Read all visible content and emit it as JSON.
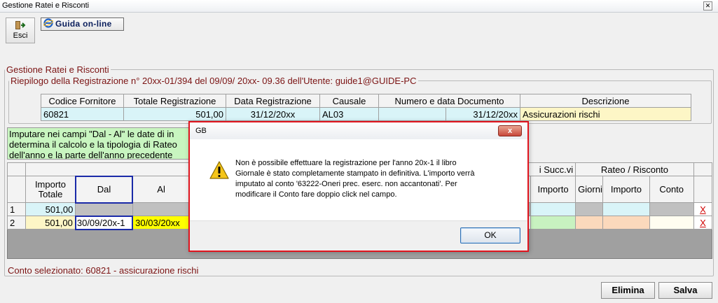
{
  "window": {
    "title": "Gestione Ratei e Risconti",
    "close_glyph": "✕"
  },
  "toolbar": {
    "esci_label": "Esci",
    "guida_label": "Guida on-line"
  },
  "main_group": {
    "legend": "Gestione Ratei e Risconti"
  },
  "riepilogo": {
    "legend": "Riepilogo della Registrazione n° 20xx-01/394  del 09/09/ 20xx- 09.36 dell'Utente: guide1@GUIDE-PC",
    "headers": [
      "Codice Fornitore",
      "Totale Registrazione",
      "Data Registrazione",
      "Causale",
      "Numero e data Documento",
      "Descrizione"
    ],
    "row": {
      "codice": "60821",
      "totale": "501,00",
      "data": "31/12/20xx",
      "causale": "AL03",
      "numero": "",
      "data_doc": "31/12/20xx",
      "descrizione": "Assicurazioni rischi"
    }
  },
  "info_box": {
    "lines": [
      "Imputare nei campi \"Dal - Al\" le date di in",
      "determina il calcolo e la tipologia di Rateo",
      "dell'anno e la parte dell'anno precedente"
    ]
  },
  "grid": {
    "group_succ": "i Succ.vi",
    "group_rateo": "Rateo / Risconto",
    "headers": {
      "importo_totale": "Importo Totale",
      "dal": "Dal",
      "al": "Al",
      "importo": "Importo",
      "giorni": "Giorni",
      "importo2": "Importo",
      "conto": "Conto"
    },
    "rows": [
      {
        "num": "1",
        "importo_totale": "501,00",
        "dal": "",
        "al": "",
        "delete": "X"
      },
      {
        "num": "2",
        "importo_totale": "501,00",
        "dal": "30/09/20x-1",
        "al": "30/03/20xx",
        "delete": "X"
      }
    ]
  },
  "status": {
    "text": "Conto selezionato: 60821 - assicurazione rischi"
  },
  "buttons": {
    "elimina": "Elimina",
    "salva": "Salva"
  },
  "dialog": {
    "title": "GB",
    "close_glyph": "x",
    "message_lines": [
      "Non è possibile effettuare la registrazione per l'anno 20x-1 il libro",
      "Giornale è stato completamente stampato in definitiva. L'importo verrà",
      "imputato al conto '63222-Oneri prec. eserc. non accantonati'. Per",
      "modificare il Conto fare doppio click nel campo."
    ],
    "ok_label": "OK",
    "icon": "warning-icon"
  },
  "colors": {
    "legend_text": "#7b1313",
    "cyan_cell": "#d9f4f8",
    "yellow_cell": "#fdf6c6",
    "info_green": "#c8f5c0",
    "highlight_yellow": "#ffff00",
    "dialog_border": "#e0141e"
  }
}
